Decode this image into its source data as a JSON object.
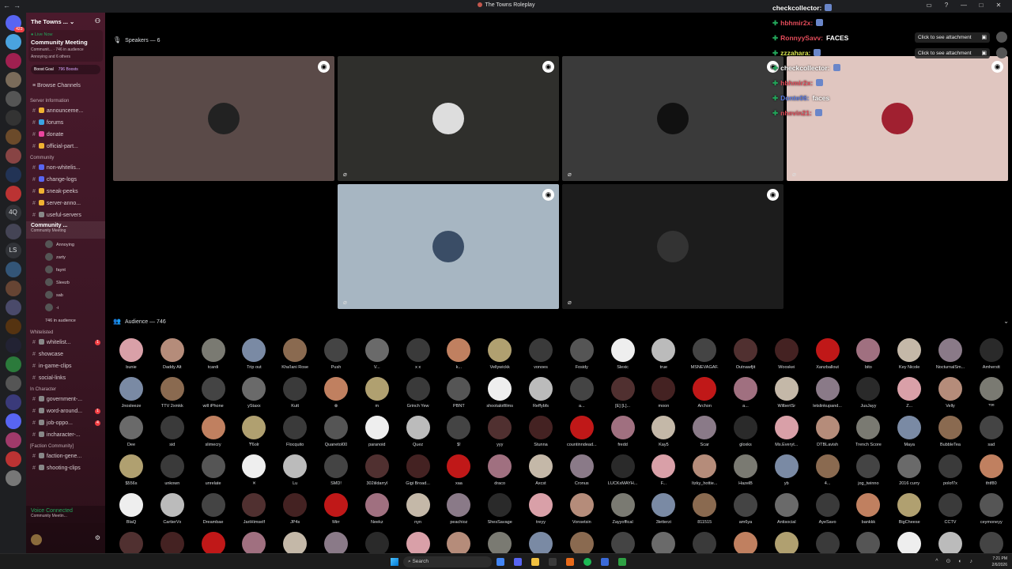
{
  "window": {
    "title": "The Towns Roleplay"
  },
  "rail": {
    "servers": [
      {
        "badge": "423",
        "color": "#5865f2",
        "label": ""
      },
      {
        "badge": "",
        "color": "#4aa3df",
        "label": ""
      },
      {
        "badge": "",
        "color": "#a02050",
        "label": ""
      },
      {
        "badge": "",
        "color": "#7a6b5a",
        "label": ""
      },
      {
        "badge": "",
        "color": "#555",
        "label": ""
      },
      {
        "badge": "",
        "color": "#333",
        "label": ""
      },
      {
        "badge": "",
        "color": "#6b4a2a",
        "label": ""
      },
      {
        "badge": "",
        "color": "#884444",
        "label": ""
      },
      {
        "badge": "",
        "color": "#223355",
        "label": ""
      },
      {
        "badge": "",
        "color": "#b33",
        "label": ""
      },
      {
        "badge": "",
        "color": "",
        "label": "4Q"
      },
      {
        "badge": "",
        "color": "#445",
        "label": ""
      },
      {
        "badge": "",
        "color": "",
        "label": "LS"
      },
      {
        "badge": "",
        "color": "#335577",
        "label": ""
      },
      {
        "badge": "",
        "color": "#664433",
        "label": ""
      },
      {
        "badge": "",
        "color": "#4a4a6a",
        "label": ""
      },
      {
        "badge": "",
        "color": "#553311",
        "label": ""
      },
      {
        "badge": "",
        "color": "#223",
        "label": ""
      },
      {
        "badge": "",
        "color": "#2b7a3b",
        "label": ""
      },
      {
        "badge": "",
        "color": "#555",
        "label": ""
      },
      {
        "badge": "",
        "color": "#3a3a7a",
        "label": ""
      },
      {
        "badge": "",
        "color": "#5865f2",
        "label": ""
      },
      {
        "badge": "",
        "color": "#a03a6a",
        "label": ""
      },
      {
        "badge": "",
        "color": "#b33",
        "label": ""
      },
      {
        "badge": "",
        "color": "#777",
        "label": ""
      }
    ]
  },
  "sidebar": {
    "server_name": "The Towns ...",
    "live": {
      "tag": "● Live Now",
      "title": "Community Meeting",
      "sub": "Communit... · 746 in audience",
      "people": "Annoying and 6 others"
    },
    "boost": {
      "label": "Boost Goal",
      "count": "796 Boosts"
    },
    "browse": "Browse Channels",
    "categories": [
      {
        "name": "Server Information",
        "channels": [
          {
            "label": "announceme...",
            "color": "#f0b232",
            "count": ""
          },
          {
            "label": "forums",
            "color": "#3ba4e2",
            "count": ""
          },
          {
            "label": "donate",
            "color": "#eb459e",
            "count": ""
          },
          {
            "label": "official-part...",
            "color": "#f0b232",
            "count": ""
          }
        ]
      },
      {
        "name": "Community",
        "channels": [
          {
            "label": "non-whitelis...",
            "color": "#5865f2",
            "count": ""
          },
          {
            "label": "change-logs",
            "color": "#5865f2",
            "count": ""
          },
          {
            "label": "sneak-peeks",
            "color": "#f0b232",
            "count": ""
          },
          {
            "label": "server-anno...",
            "color": "#f0b232",
            "count": ""
          },
          {
            "label": "useful-servers",
            "color": "#888",
            "count": ""
          }
        ]
      }
    ],
    "stage": {
      "name": "Community ...",
      "sub": "Community Meeting",
      "users": [
        "Annoying",
        "zarty",
        "faynt",
        "Sleezb",
        "sab",
        "-i"
      ],
      "audience_note": "746 in audience"
    },
    "categories2": [
      {
        "name": "Whitelisted",
        "channels": [
          {
            "label": "whitelist...",
            "color": "#888",
            "count": "1"
          },
          {
            "label": "showcase",
            "color": "",
            "count": ""
          },
          {
            "label": "in-game-clips",
            "color": "",
            "count": ""
          },
          {
            "label": "social-links",
            "color": "",
            "count": ""
          }
        ]
      },
      {
        "name": "In Character",
        "channels": [
          {
            "label": "government-...",
            "color": "#888",
            "count": ""
          },
          {
            "label": "word-around...",
            "color": "#888",
            "count": "1"
          },
          {
            "label": "job-oppo...",
            "color": "#888",
            "count": "4"
          },
          {
            "label": "incharacter-...",
            "color": "#888",
            "count": ""
          }
        ]
      },
      {
        "name": "[Faction Community]",
        "channels": [
          {
            "label": "faction-gene...",
            "color": "#888",
            "count": ""
          },
          {
            "label": "shooting-clips",
            "color": "#888",
            "count": ""
          }
        ]
      }
    ],
    "voice": {
      "status": "Voice Connected",
      "sub": "Community Meetin..."
    }
  },
  "stage": {
    "speakers_title": "Speakers — 6",
    "audience_title": "Audience — 746",
    "speakers": [
      {
        "bg": "#5a4a48",
        "av": "#222"
      },
      {
        "bg": "#2f2f2c",
        "av": "#ddd"
      },
      {
        "bg": "#3a3a3a",
        "av": "#111"
      },
      {
        "bg": "#e0c6c0",
        "av": "#a02030"
      },
      {
        "bg": "#a7b6c2",
        "av": "#3a4d66"
      },
      {
        "bg": "#1c1c1c",
        "av": "#333"
      }
    ],
    "audience": [
      [
        "bunie",
        "Daddy Alt",
        "tcardi",
        "Trip out",
        "Kha'lani Rose",
        "Push",
        "V...",
        "x x",
        "k...",
        "Vellywickk",
        "vonoes",
        "Fosidy",
        "Slexic",
        "true",
        "MSNEVAGAF.",
        "Outnawfjit",
        "Wooskei",
        "Xanzballout",
        "bito",
        "Key Nicole",
        "NocturnalSm...",
        "Amherstt"
      ],
      [
        "Jnosleeze",
        "TTV 2xmkk",
        "will iPhone",
        "yStaxx",
        "Kutt",
        "⊗",
        "m",
        "Grinch Yew",
        "PBNT",
        "shootalotfilms",
        "Reffybfs",
        "a...",
        "[E] [L]...",
        "moon",
        "Archon",
        "a...",
        "WilbertSr",
        "letslinkupand...",
        "JusJayy",
        "Z...",
        "Velly",
        "ᵀᴳᴮ"
      ],
      [
        "Dee",
        "sid",
        "slimecry",
        "Ɏ6olr",
        "Flocquito",
        "Quanetol00",
        "paranoid",
        "Quez",
        "$!",
        "yyy",
        "Stunna",
        "countinndead...",
        "fredd",
        "Kay5",
        "Scar",
        "gloxks",
        "Ms.Everyt...",
        "DTBLavish",
        "Trench Score",
        "Maya",
        "BubbleTea",
        "sad"
      ],
      [
        "$556s",
        "unkown",
        "unrelate",
        "✕",
        "Lu",
        "SMD!",
        "302iildarryl",
        "Gigi Broad...",
        "xaa",
        "draco",
        "Axcst",
        "Cronus",
        "LUCKxMAYH...",
        "F...",
        "Itzky_hottie...",
        "HazelB",
        "yb",
        "4...",
        "jog_twinno",
        "2016 curry",
        "polof7x",
        "thtf80"
      ],
      [
        "BlaQ",
        "CartierVx",
        "Dreambae",
        "JariHimself",
        "JP4s",
        "Mirr",
        "Neekz",
        "nyn",
        "peachioz",
        "ShesSavage",
        "treyy",
        "Vonsetsin",
        "Zayyoffical",
        "3letterzi",
        "811515",
        "am6ya",
        "Antisocial",
        "AyeSavo",
        "bankkk",
        "BigCheese",
        "CCTV",
        "ceymoneyy"
      ],
      [
        "",
        "",
        "",
        "",
        "",
        "",
        "",
        "",
        "",
        "",
        "",
        "",
        "",
        "",
        "",
        "",
        "",
        "",
        "",
        "",
        "",
        ""
      ]
    ],
    "audience_colors": [
      "#d9a0a8",
      "#b58c7a",
      "#7a7a72",
      "#7a8aa4",
      "#8a6a50",
      "#444",
      "#6a6a6a",
      "#3a3a3a",
      "#c08060",
      "#b0a070",
      "#3a3a3a",
      "#555",
      "#eee",
      "#bbb",
      "#444",
      "#503030",
      "#442222",
      "#c01818",
      "#a07080",
      "#c4b8a8",
      "#8a7a88",
      "#2a2a2a"
    ]
  },
  "overlay": {
    "lines": [
      {
        "user": "checkcollector:",
        "text": "",
        "color": "#ffffff",
        "fade": false
      },
      {
        "user": "hbhmir2x:",
        "text": "",
        "color": "#e34c5a",
        "fade": false
      },
      {
        "user": "RonnyySavv:",
        "text": "FACES",
        "color": "#e34c5a",
        "fade": false
      },
      {
        "user": "zzzahara:",
        "text": "",
        "color": "#d7e34c",
        "fade": false
      },
      {
        "user": "checkcollector:",
        "text": "",
        "color": "#ffffff",
        "fade": false
      },
      {
        "user": "hbhmir2x:",
        "text": "",
        "color": "#e34c5a",
        "fade": false
      },
      {
        "user": "Donte06:",
        "text": "faces",
        "color": "#5a7ae3",
        "fade": false
      },
      {
        "user": "nhevin21:",
        "text": "",
        "color": "#e34c5a",
        "fade": false
      }
    ],
    "attachment_label": "Click to see attachment"
  },
  "taskbar": {
    "search": "Search",
    "time": "7:21 PM",
    "date": "2/6/2026"
  }
}
